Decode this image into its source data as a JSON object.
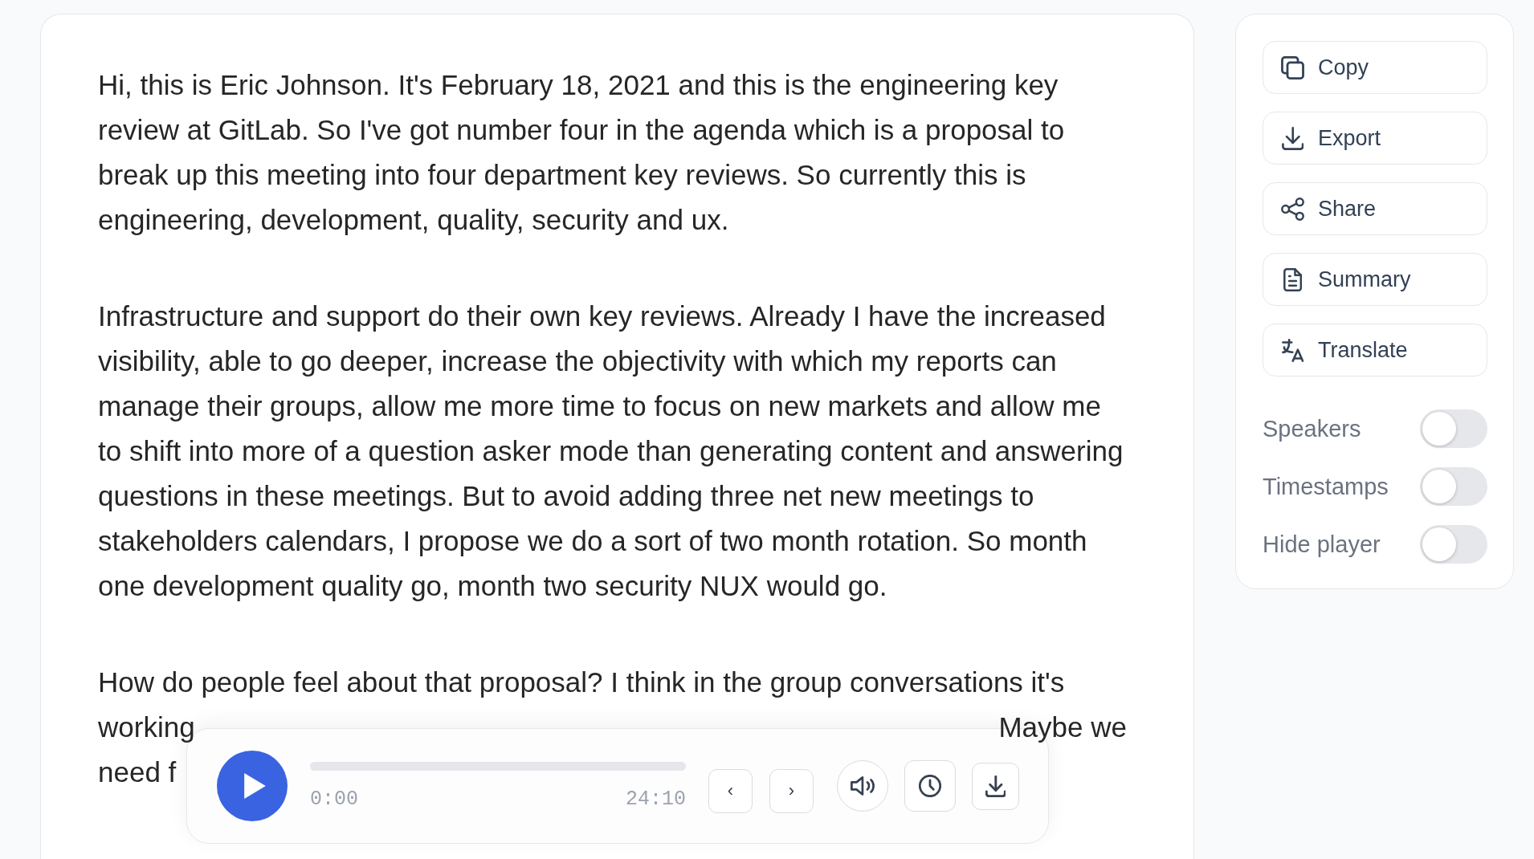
{
  "transcript": {
    "paragraphs": [
      "Hi, this is Eric Johnson. It's February 18, 2021 and this is the engineering key review at GitLab. So I've got number four in the agenda which is a proposal to break up this meeting into four department key reviews. So currently this is engineering, development, quality, security and ux.",
      "Infrastructure and support do their own key reviews. Already I have the increased visibility, able to go deeper, increase the objectivity with which my reports can manage their groups, allow me more time to focus on new markets and allow me to shift into more of a question asker mode than generating content and answering questions in these meetings. But to avoid adding three net new meetings to stakeholders calendars, I propose we do a sort of two month rotation. So month one development quality go, month two security NUX would go."
    ],
    "partly_covered_paragraph": {
      "lines": [
        {
          "parts": [
            "How do people feel about that proposal? I think in the group conversations it's"
          ]
        },
        {
          "parts": [
            "working",
            "Maybe we"
          ]
        },
        {
          "parts": [
            "need f"
          ]
        }
      ]
    }
  },
  "player": {
    "playing": false,
    "progress": {
      "level": 0
    },
    "elapsed": "0:00",
    "duration": "24:10",
    "previous": "‹",
    "next": "›"
  },
  "actions": [
    {
      "kind": "copy",
      "label": "Copy"
    },
    {
      "kind": "export",
      "label": "Export"
    },
    {
      "kind": "share",
      "label": "Share"
    },
    {
      "kind": "summary",
      "label": "Summary"
    },
    {
      "kind": "translate",
      "label": "Translate"
    }
  ],
  "toggles": [
    {
      "label": "Speakers",
      "on": false
    },
    {
      "label": "Timestamps",
      "on": false
    },
    {
      "label": "Hide player",
      "on": false
    }
  ]
}
